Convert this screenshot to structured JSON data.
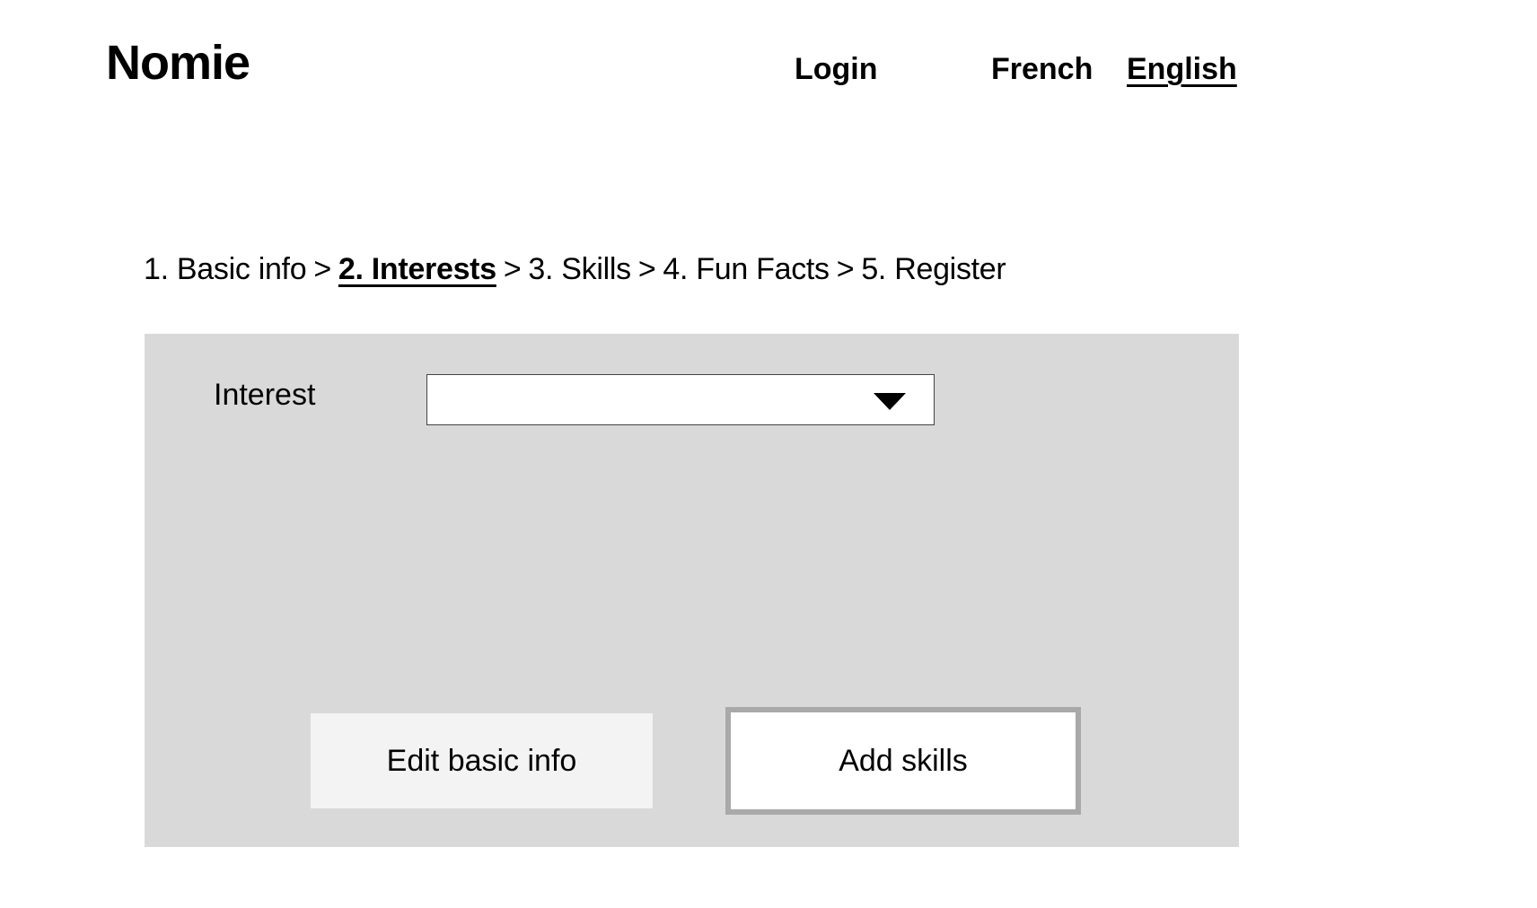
{
  "header": {
    "logo": "Nomie",
    "login_label": "Login",
    "languages": [
      {
        "label": "French",
        "selected": false
      },
      {
        "label": "English",
        "selected": true
      }
    ]
  },
  "steps": {
    "separator": ">",
    "items": [
      {
        "label": "1. Basic info",
        "active": false
      },
      {
        "label": "2. Interests",
        "active": true
      },
      {
        "label": "3. Skills",
        "active": false
      },
      {
        "label": "4. Fun Facts",
        "active": false
      },
      {
        "label": "5. Register",
        "active": false
      }
    ]
  },
  "form": {
    "interest_label": "Interest",
    "interest_value": "",
    "dropdown_icon": "caret-down-icon"
  },
  "actions": {
    "back_label": "Edit basic info",
    "next_label": "Add skills"
  }
}
